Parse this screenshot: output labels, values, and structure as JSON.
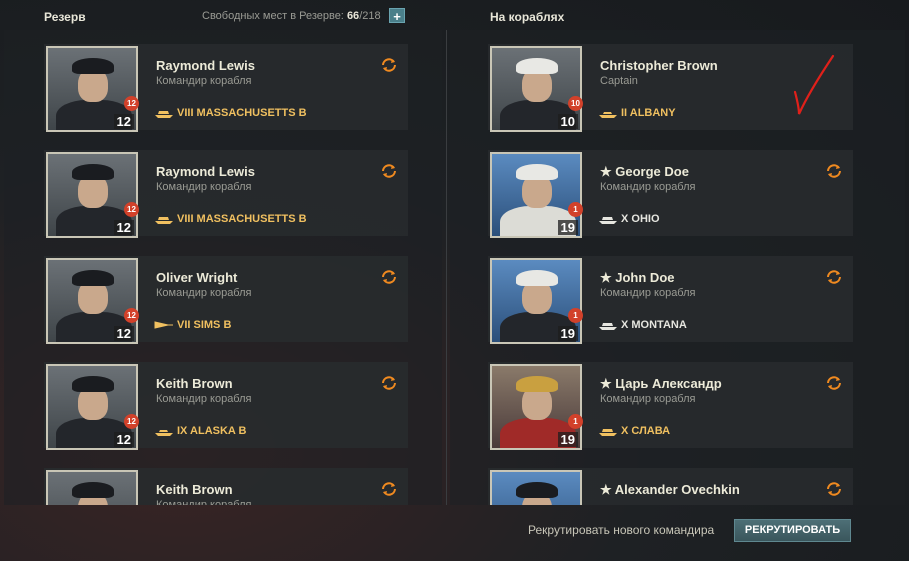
{
  "reserve": {
    "title": "Резерв",
    "free_label": "Свободных мест в Резерве:",
    "free_count": "66",
    "total": "/218",
    "add_label": "+"
  },
  "onships": {
    "title": "На кораблях"
  },
  "left_cards": [
    {
      "name": "Raymond Lewis",
      "role": "Командир корабля",
      "ship": "VIII MASSACHUSETTS B",
      "level": "12",
      "badge": "12"
    },
    {
      "name": "Raymond Lewis",
      "role": "Командир корабля",
      "ship": "VIII MASSACHUSETTS B",
      "level": "12",
      "badge": "12"
    },
    {
      "name": "Oliver Wright",
      "role": "Командир корабля",
      "ship": "VII SIMS B",
      "level": "12",
      "badge": "12"
    },
    {
      "name": "Keith Brown",
      "role": "Командир корабля",
      "ship": "IX ALASKA B",
      "level": "12",
      "badge": "12"
    },
    {
      "name": "Keith Brown",
      "role": "Командир корабля",
      "ship": "",
      "level": "",
      "badge": ""
    }
  ],
  "right_cards": [
    {
      "name": "Christopher Brown",
      "role": "Captain",
      "ship": "II ALBANY",
      "level": "10",
      "badge": "10"
    },
    {
      "name": "★ George Doe",
      "role": "Командир корабля",
      "ship": "X OHIO",
      "level": "19",
      "badge": "1"
    },
    {
      "name": "★ John Doe",
      "role": "Командир корабля",
      "ship": "X MONTANA",
      "level": "19",
      "badge": "1"
    },
    {
      "name": "★ Царь Александр",
      "role": "Командир корабля",
      "ship": "X СЛАВА",
      "level": "19",
      "badge": "1"
    },
    {
      "name": "★ Alexander Ovechkin",
      "role": "",
      "ship": "",
      "level": "",
      "badge": ""
    }
  ],
  "footer": {
    "recruit_text": "Рекрутировать нового командира",
    "recruit_button": "РЕКРУТИРОВАТЬ"
  },
  "colors": {
    "accent_orange": "#f08a20",
    "ship_gold": "#f0c060",
    "badge_red": "#d2412a",
    "check_red": "#e0201a"
  }
}
